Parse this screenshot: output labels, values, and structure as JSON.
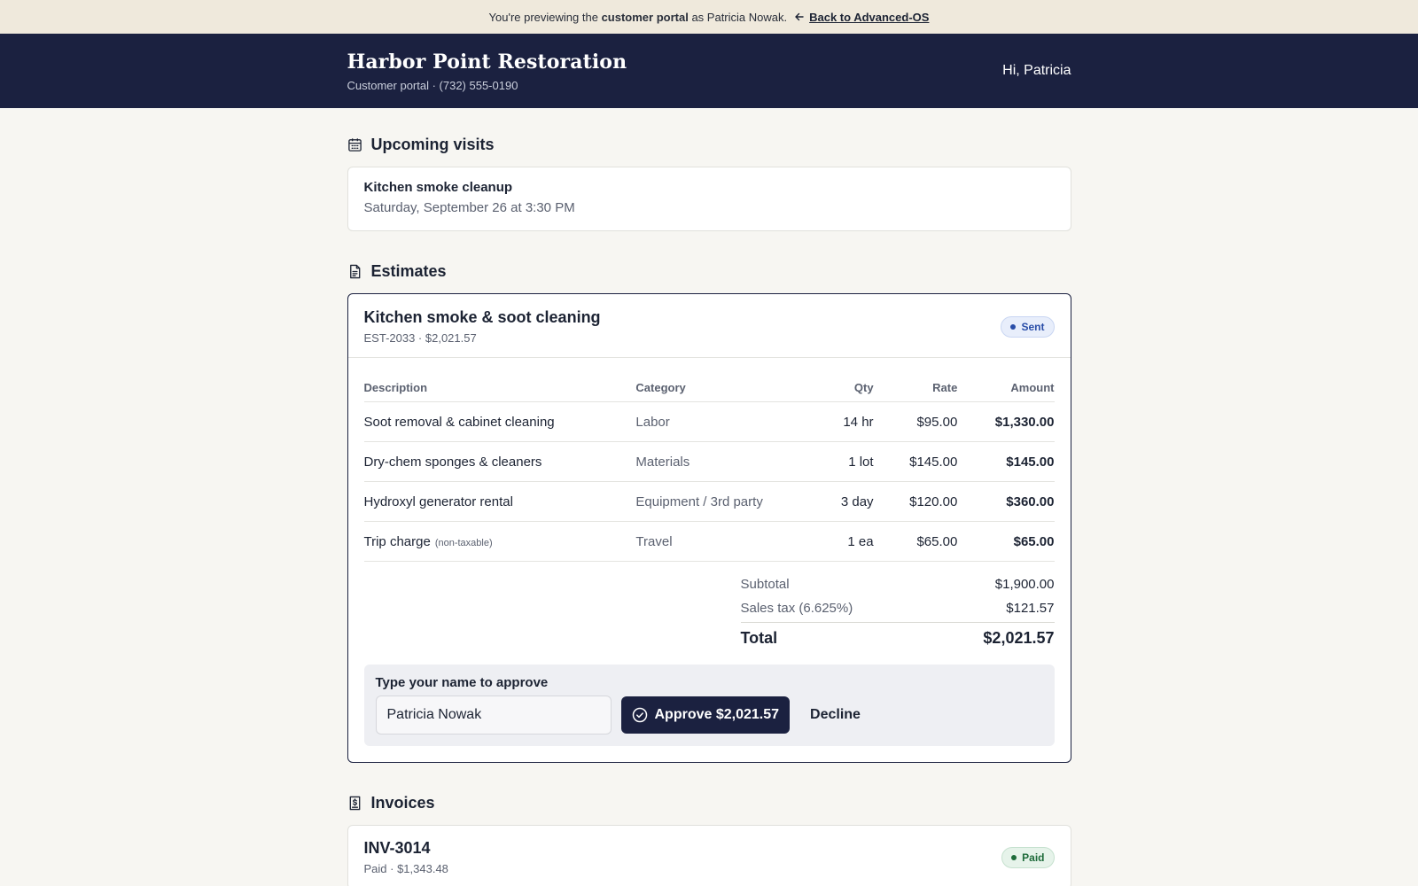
{
  "preview": {
    "prefix": "You're previewing the",
    "bold": "customer portal",
    "suffix": "as Patricia Nowak.",
    "back_label": "Back to Advanced-OS"
  },
  "header": {
    "company": "Harbor Point Restoration",
    "subtitle": "Customer portal · (732) 555-0190",
    "greeting": "Hi, Patricia"
  },
  "visits": {
    "heading": "Upcoming visits",
    "items": [
      {
        "title": "Kitchen smoke cleanup",
        "when": "Saturday, September 26 at 3:30 PM"
      }
    ]
  },
  "estimates": {
    "heading": "Estimates",
    "items": [
      {
        "title": "Kitchen smoke & soot cleaning",
        "meta": "EST-2033 · $2,021.57",
        "status": "Sent",
        "columns": [
          "Description",
          "Category",
          "Qty",
          "Rate",
          "Amount"
        ],
        "rows": [
          {
            "description": "Soot removal & cabinet cleaning",
            "note": "",
            "category": "Labor",
            "qty": "14 hr",
            "rate": "$95.00",
            "amount": "$1,330.00"
          },
          {
            "description": "Dry-chem sponges & cleaners",
            "note": "",
            "category": "Materials",
            "qty": "1 lot",
            "rate": "$145.00",
            "amount": "$145.00"
          },
          {
            "description": "Hydroxyl generator rental",
            "note": "",
            "category": "Equipment / 3rd party",
            "qty": "3 day",
            "rate": "$120.00",
            "amount": "$360.00"
          },
          {
            "description": "Trip charge",
            "note": "(non-taxable)",
            "category": "Travel",
            "qty": "1 ea",
            "rate": "$65.00",
            "amount": "$65.00"
          }
        ],
        "subtotal_label": "Subtotal",
        "subtotal": "$1,900.00",
        "tax_label": "Sales tax (6.625%)",
        "tax": "$121.57",
        "total_label": "Total",
        "total": "$2,021.57",
        "approve_label": "Type your name to approve",
        "name_value": "Patricia Nowak",
        "approve_button": "Approve $2,021.57",
        "decline_button": "Decline"
      }
    ]
  },
  "invoices": {
    "heading": "Invoices",
    "items": [
      {
        "title": "INV-3014",
        "meta": "Paid · $1,343.48",
        "status": "Paid"
      }
    ]
  },
  "colors": {
    "navy": "#1b2140",
    "banner": "#efe9dc",
    "background": "#f7f6f2",
    "sent_badge": "#2a4ea8",
    "paid_badge": "#1e6b3a"
  }
}
